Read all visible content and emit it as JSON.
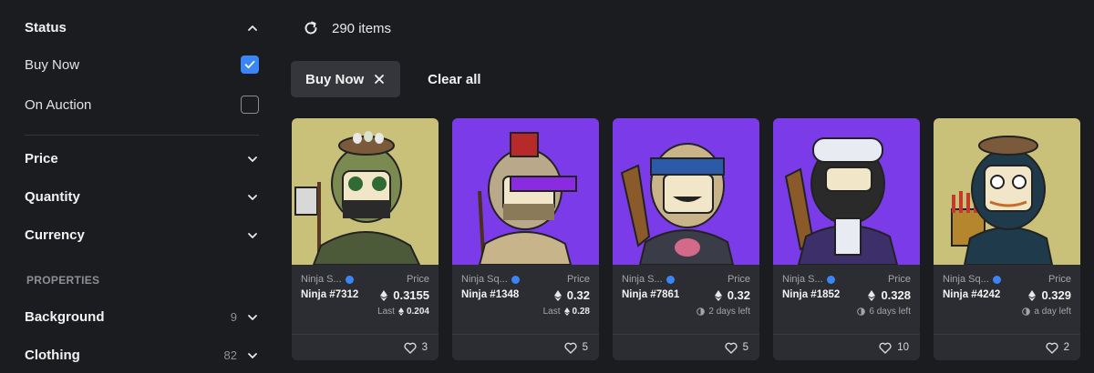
{
  "sidebar": {
    "status": {
      "title": "Status",
      "options": [
        {
          "label": "Buy Now",
          "checked": true
        },
        {
          "label": "On Auction",
          "checked": false
        }
      ]
    },
    "filters": [
      {
        "label": "Price"
      },
      {
        "label": "Quantity"
      },
      {
        "label": "Currency"
      }
    ],
    "properties_header": "PROPERTIES",
    "properties": [
      {
        "label": "Background",
        "count": "9"
      },
      {
        "label": "Clothing",
        "count": "82"
      }
    ]
  },
  "main": {
    "item_count": "290 items",
    "active_chip": "Buy Now",
    "clear_all": "Clear all",
    "cards": [
      {
        "collection": "Ninja S...",
        "name": "Ninja #7312",
        "price_label": "Price",
        "price": "0.3155",
        "sub_label": "Last",
        "sub_value": "0.204",
        "sub_type": "last",
        "likes": "3",
        "bg": "#c9c17a"
      },
      {
        "collection": "Ninja Sq...",
        "name": "Ninja #1348",
        "price_label": "Price",
        "price": "0.32",
        "sub_label": "Last",
        "sub_value": "0.28",
        "sub_type": "last",
        "likes": "5",
        "bg": "#7b3be8"
      },
      {
        "collection": "Ninja S...",
        "name": "Ninja #7861",
        "price_label": "Price",
        "price": "0.32",
        "sub_label": "",
        "sub_value": "2 days left",
        "sub_type": "time",
        "likes": "5",
        "bg": "#7b3be8"
      },
      {
        "collection": "Ninja S...",
        "name": "Ninja #1852",
        "price_label": "Price",
        "price": "0.328",
        "sub_label": "",
        "sub_value": "6 days left",
        "sub_type": "time",
        "likes": "10",
        "bg": "#7b3be8"
      },
      {
        "collection": "Ninja Sq...",
        "name": "Ninja #4242",
        "price_label": "Price",
        "price": "0.329",
        "sub_label": "",
        "sub_value": "a day left",
        "sub_type": "time",
        "likes": "2",
        "bg": "#c9c17a"
      }
    ]
  },
  "colors": {
    "background": "#1b1c1f",
    "card": "#2c2d32",
    "accent": "#3a86f7",
    "art_yellow": "#c9c17a",
    "art_purple": "#7b3be8"
  }
}
